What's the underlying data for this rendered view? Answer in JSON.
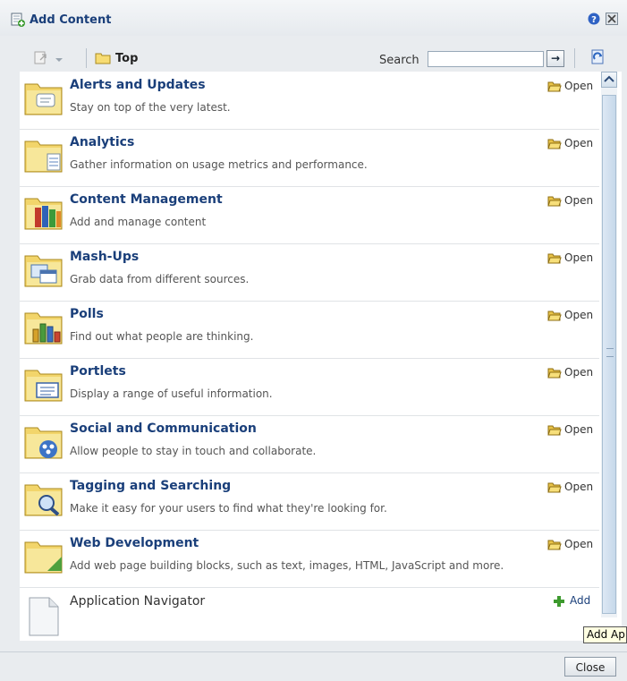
{
  "dialog": {
    "title": "Add Content",
    "help_icon": "help-icon",
    "close_icon": "close-icon"
  },
  "toolbar": {
    "breadcrumb_top": "Top",
    "search_label": "Search",
    "search_value": "",
    "go_label": "→"
  },
  "items": [
    {
      "title": "Alerts and Updates",
      "desc": "Stay on top of the very latest.",
      "icon": "folder-alerts-icon",
      "action": "Open"
    },
    {
      "title": "Analytics",
      "desc": "Gather information on usage metrics and performance.",
      "icon": "folder-analytics-icon",
      "action": "Open"
    },
    {
      "title": "Content Management",
      "desc": "Add and manage content",
      "icon": "folder-content-icon",
      "action": "Open"
    },
    {
      "title": "Mash-Ups",
      "desc": "Grab data from different sources.",
      "icon": "folder-mashups-icon",
      "action": "Open"
    },
    {
      "title": "Polls",
      "desc": "Find out what people are thinking.",
      "icon": "folder-polls-icon",
      "action": "Open"
    },
    {
      "title": "Portlets",
      "desc": "Display a range of useful information.",
      "icon": "folder-portlets-icon",
      "action": "Open"
    },
    {
      "title": "Social and Communication",
      "desc": "Allow people to stay in touch and collaborate.",
      "icon": "folder-social-icon",
      "action": "Open"
    },
    {
      "title": "Tagging and Searching",
      "desc": "Make it easy for your users to find what they're looking for.",
      "icon": "folder-search-icon",
      "action": "Open"
    },
    {
      "title": "Web Development",
      "desc": "Add web page building blocks, such as text, images, HTML, JavaScript and more.",
      "icon": "folder-webdev-icon",
      "action": "Open"
    }
  ],
  "app_navigator": {
    "title": "Application Navigator",
    "action": "Add"
  },
  "tooltip": "Add Ap",
  "footer": {
    "close_label": "Close"
  }
}
